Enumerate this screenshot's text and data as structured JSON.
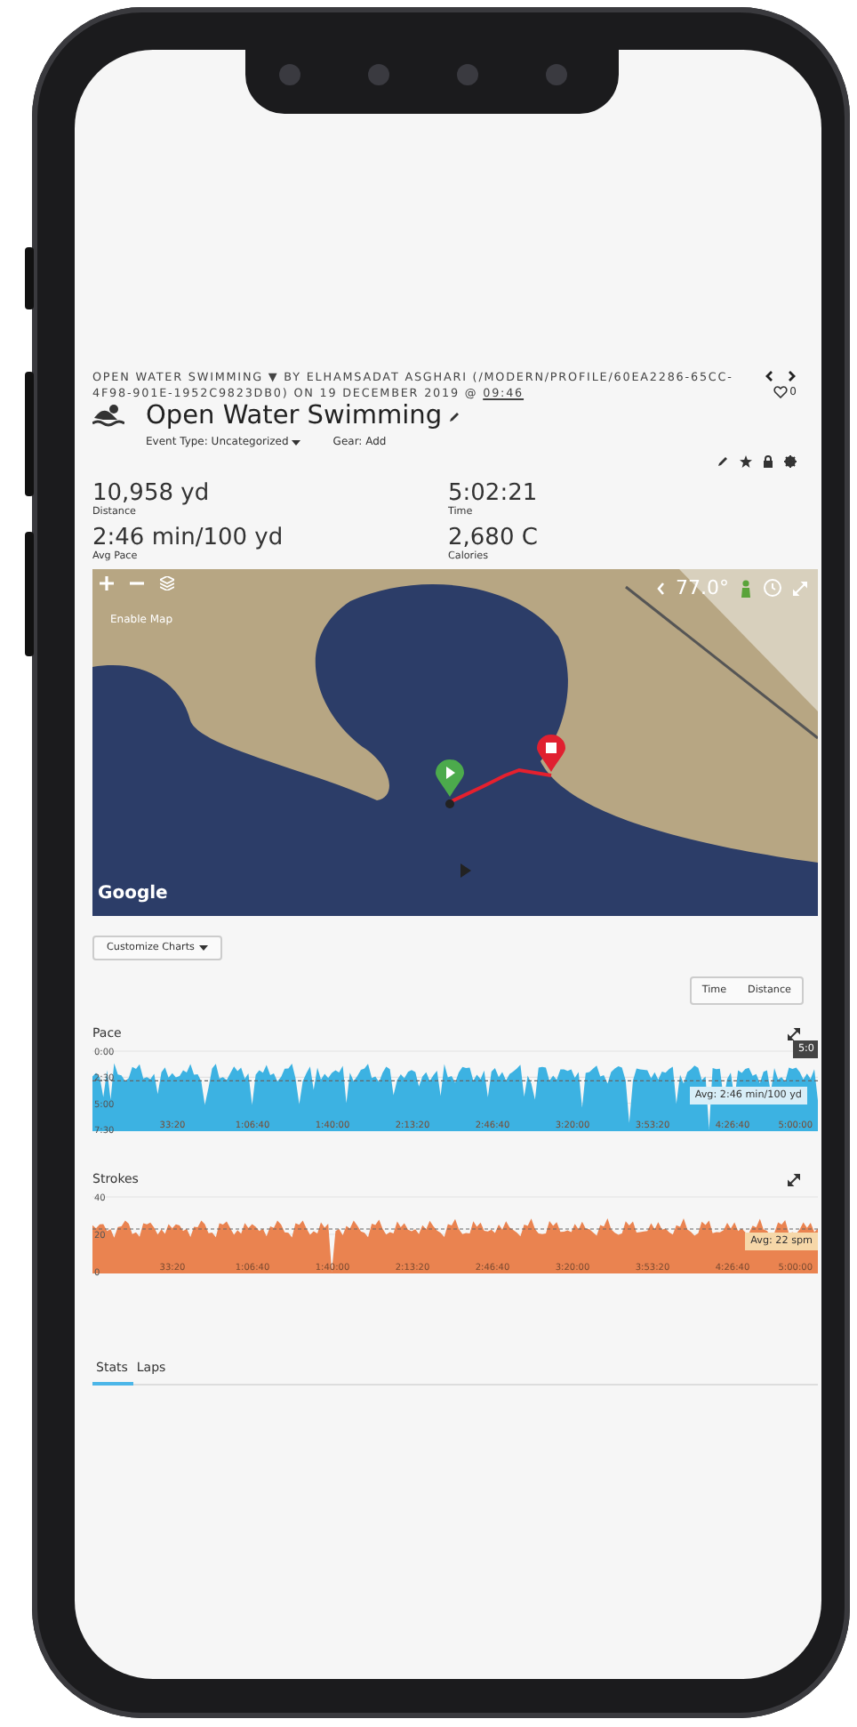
{
  "header": {
    "byline": "OPEN WATER SWIMMING ▼ BY ELHAMSADAT ASGHARI (/MODERN/PROFILE/60EA2286-65CC-4F98-901E-1952C9823DB0) ON 19 DECEMBER 2019 @ ",
    "time": "09:46",
    "likes": "0",
    "title": "Open Water Swimming",
    "event_type": "Event Type: Uncategorized",
    "gear": "Gear: Add"
  },
  "stats": [
    {
      "value": "10,958 yd",
      "label": "Distance"
    },
    {
      "value": "5:02:21",
      "label": "Time"
    },
    {
      "value": "2:46 min/100 yd",
      "label": "Avg Pace"
    },
    {
      "value": "2,680 C",
      "label": "Calories"
    }
  ],
  "map": {
    "enable_label": "Enable Map",
    "temperature": "77.0°",
    "attribution": "Google"
  },
  "customize_button": "Customize Charts",
  "axis_toggle": [
    {
      "label": "Time",
      "selected": false
    },
    {
      "label": "Distance",
      "selected": false
    }
  ],
  "charts": [
    {
      "title": "Pace",
      "color": "#3cb2e2",
      "yticks": [
        "0:00",
        "2:30",
        "5:00",
        "7:30"
      ],
      "xticks": [
        "33:20",
        "1:06:40",
        "1:40:00",
        "2:13:20",
        "2:46:40",
        "3:20:00",
        "3:53:20",
        "4:26:40",
        "5:00:00"
      ],
      "avg_label": "Avg: 2:46 min/100 yd",
      "cursor_label": "5:0"
    },
    {
      "title": "Strokes",
      "color": "#ea8350",
      "yticks": [
        "40",
        "20",
        "0"
      ],
      "xticks": [
        "33:20",
        "1:06:40",
        "1:40:00",
        "2:13:20",
        "2:46:40",
        "3:20:00",
        "3:53:20",
        "4:26:40",
        "5:00:00"
      ],
      "avg_label": "Avg: 22 spm"
    }
  ],
  "tabs": [
    {
      "label": "Stats",
      "selected": true
    },
    {
      "label": "Laps",
      "selected": false
    }
  ]
}
